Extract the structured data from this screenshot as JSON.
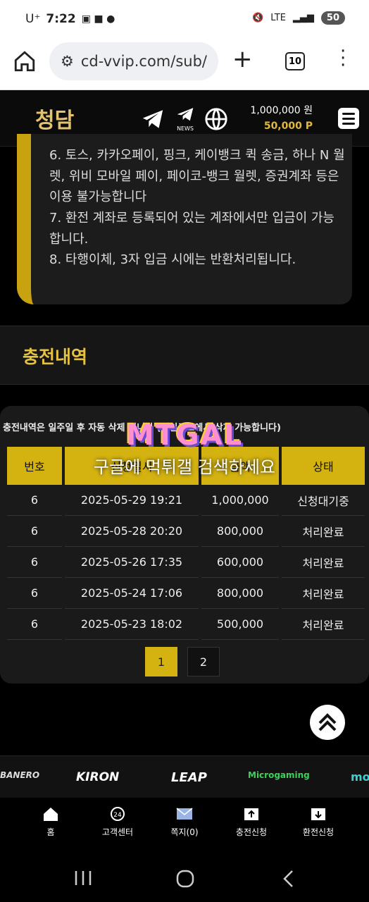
{
  "status": {
    "carrier": "U⁺",
    "time": "7:22",
    "net": "LTE",
    "battery": "50"
  },
  "browser": {
    "url": "cd-vvip.com/sub/",
    "tabs": "10"
  },
  "header": {
    "logo": "청담",
    "news_label": "NEWS",
    "balance": "1,000,000 원",
    "points": "50,000 P"
  },
  "notice": {
    "lines": [
      "6. 토스, 카카오페이, 핑크, 케이뱅크 퀵 송금, 하나 N 월렛, 위비 모바일 페이, 페이코-뱅크 월렛, 증권계좌 등은 이용 불가능합니다",
      "7. 환전 계좌로 등록되어 있는 계좌에서만 입금이 가능합니다.",
      "8. 타행이체, 3자 입금 시에는 반환처리됩니다."
    ]
  },
  "section_title": "충전내역",
  "history": {
    "note": "충전내역은 일주일 후 자동 삭제 됩니다 (메인로그에서 삭제 가능합니다)",
    "headers": [
      "번호",
      "신청일시",
      "금액",
      "상태"
    ],
    "rows": [
      [
        "6",
        "2025-05-29 19:21",
        "1,000,000",
        "신청대기중"
      ],
      [
        "6",
        "2025-05-28 20:20",
        "800,000",
        "처리완료"
      ],
      [
        "6",
        "2025-05-26 17:35",
        "600,000",
        "처리완료"
      ],
      [
        "6",
        "2025-05-24 17:06",
        "800,000",
        "처리완료"
      ],
      [
        "6",
        "2025-05-23 18:02",
        "500,000",
        "처리완료"
      ]
    ],
    "pages": [
      "1",
      "2"
    ],
    "current_page": "1"
  },
  "watermark": {
    "logo": "MTGAL",
    "text": "구글에 먹튀갤 검색하세요"
  },
  "providers": [
    "BANERO",
    "KIRON",
    "LEAP",
    "Microgaming",
    "mo"
  ],
  "bottom_nav": [
    "홈",
    "고객센터",
    "쪽지(0)",
    "충전신청",
    "환전신청"
  ],
  "colors": {
    "gold": "#d4b311",
    "accent": "#e4c243",
    "bg": "#000000"
  }
}
